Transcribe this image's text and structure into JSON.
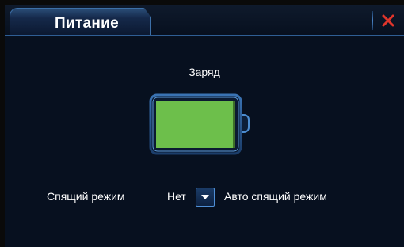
{
  "window": {
    "tab_title": "Питание",
    "close_icon": "close-x-icon"
  },
  "battery": {
    "label": "Заряд",
    "charge_fraction": 1.0,
    "fill_color": "#6dbf4b"
  },
  "sleep": {
    "label": "Спящий режим",
    "selected_value": "Нет",
    "dropdown_icon": "chevron-down-icon",
    "auto_label": "Авто спящий режим"
  },
  "colors": {
    "accent": "#3d70a8",
    "close": "#e0352b"
  }
}
